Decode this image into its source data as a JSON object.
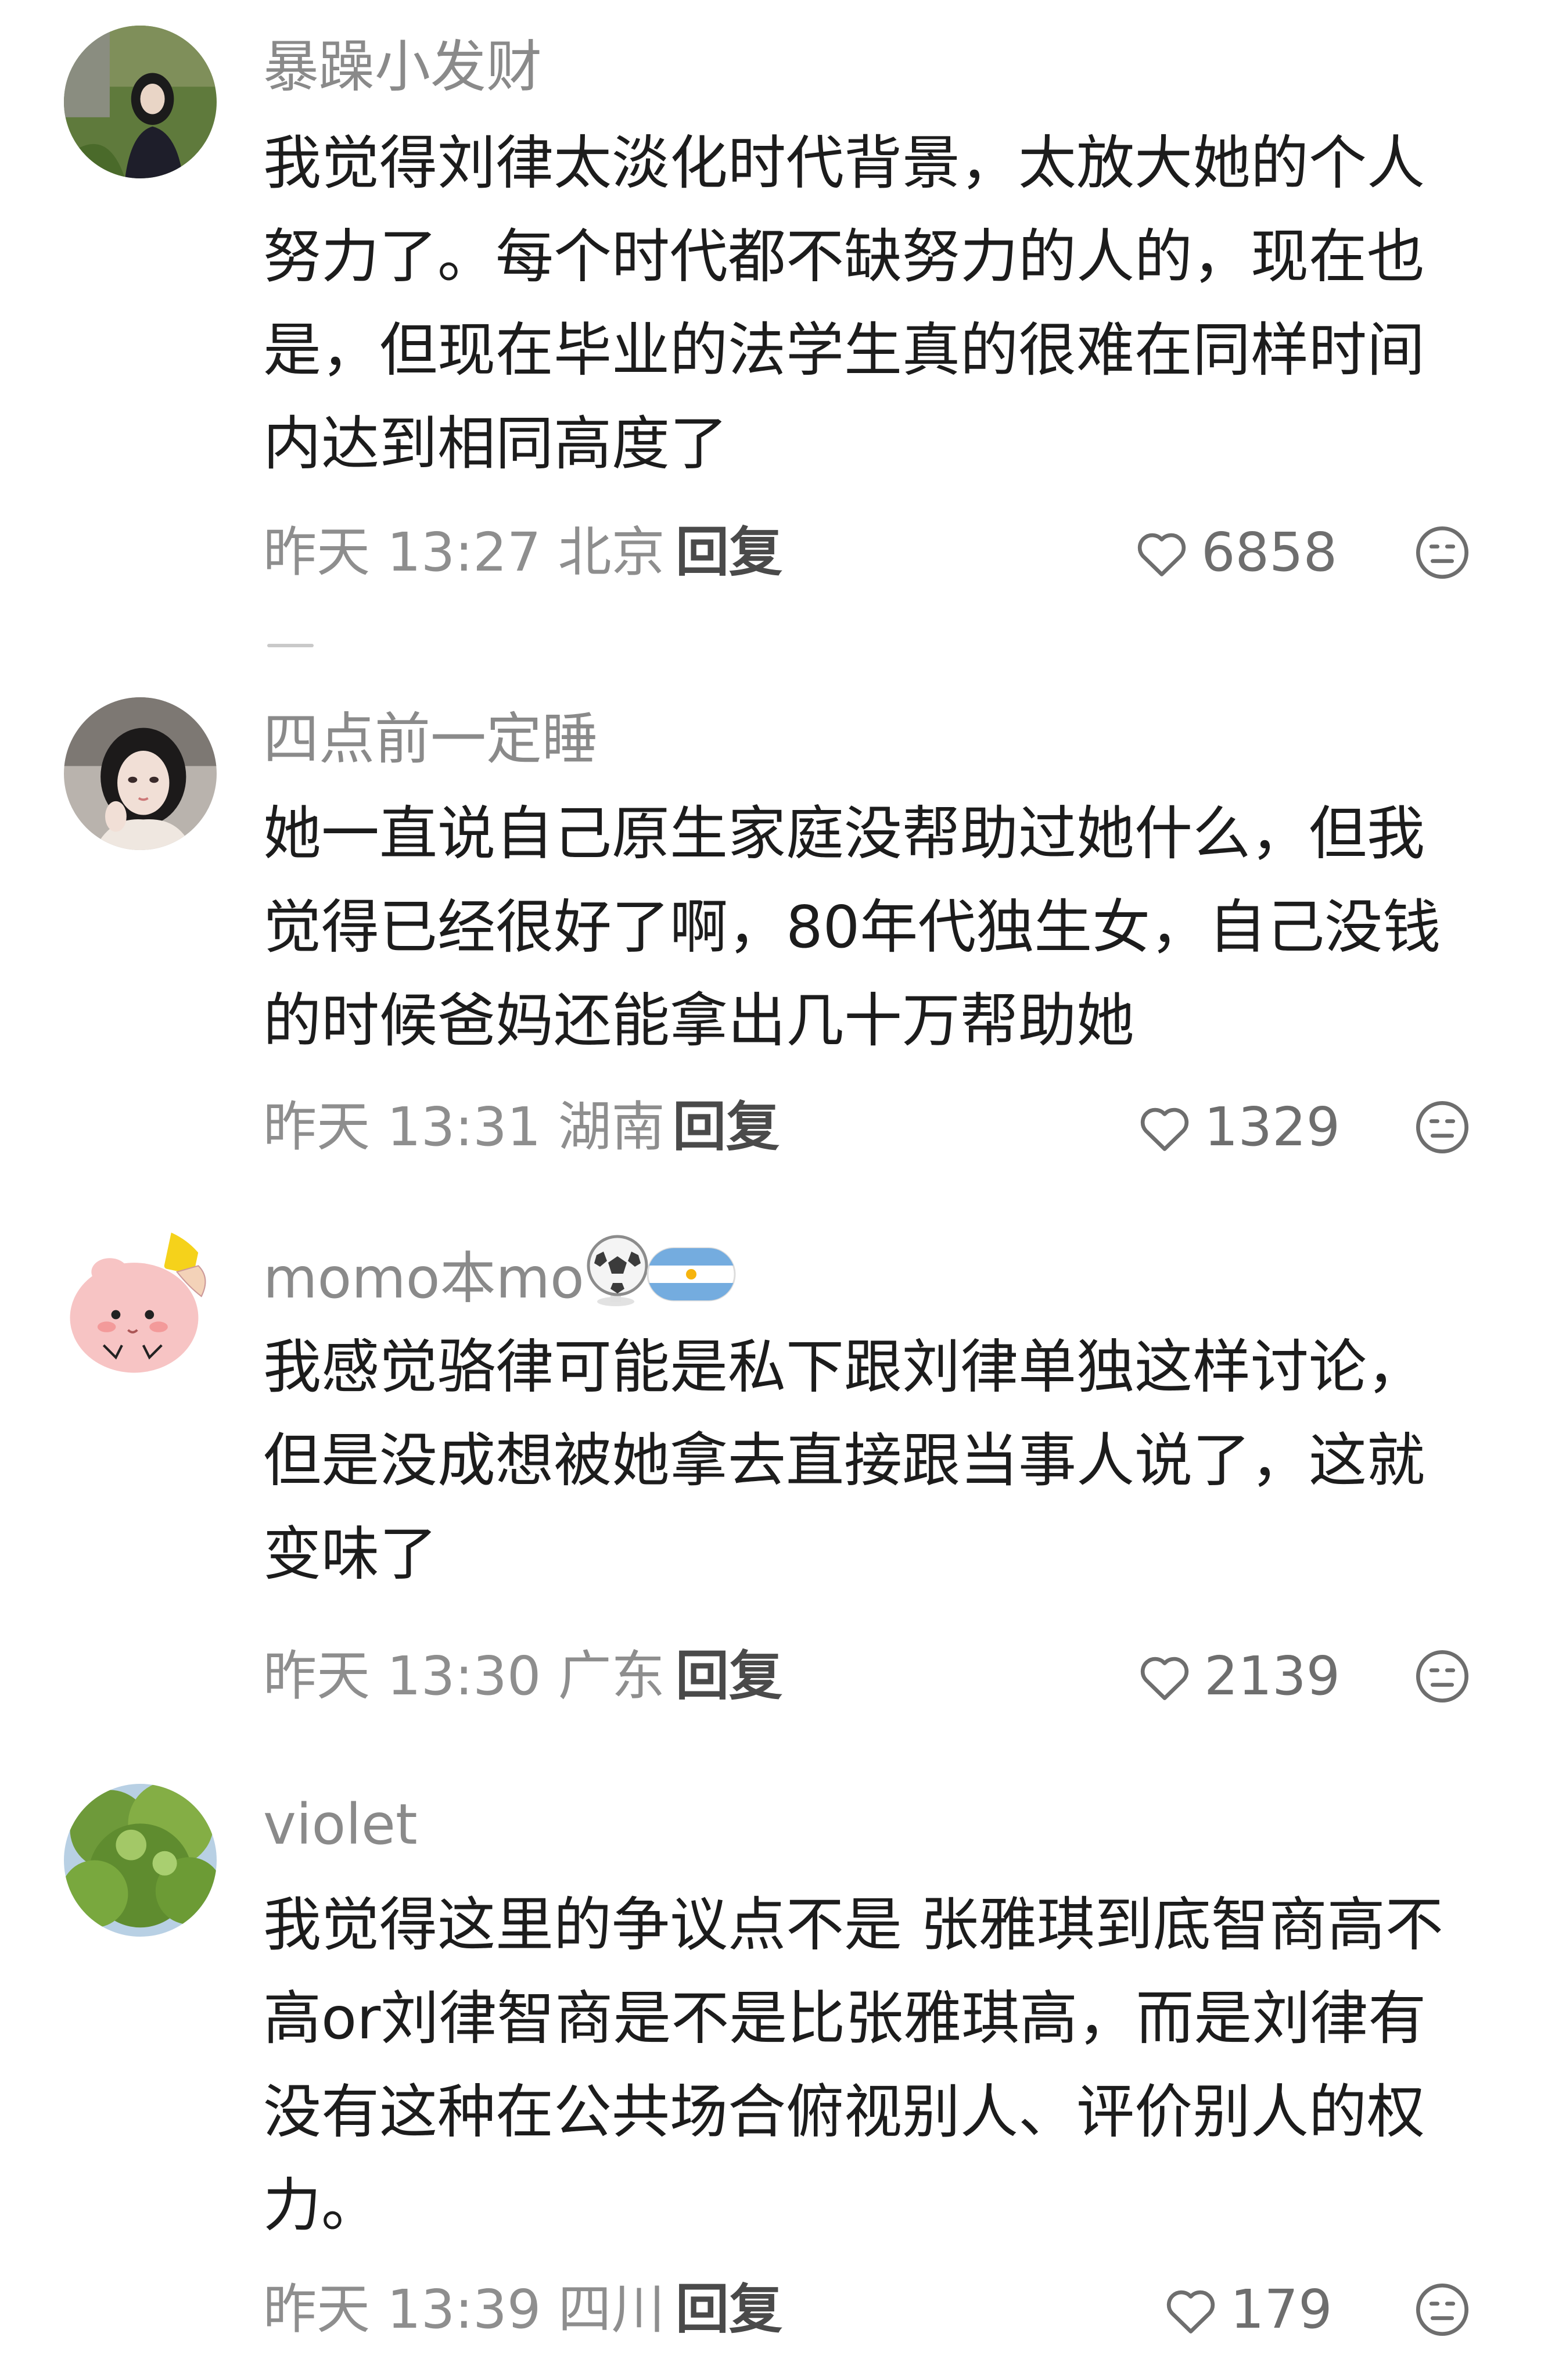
{
  "comments": [
    {
      "username": "暴躁小发财",
      "text": "我觉得刘律太淡化时代背景，太放大她的个人努力了。每个时代都不缺努力的人的，现在也是，但现在毕业的法学生真的很难在同样时间内达到相同高度了",
      "time_location": "昨天 13:27 北京",
      "reply_label": "回复",
      "likes": "6858"
    },
    {
      "username": "四点前一定睡",
      "text": "她一直说自己原生家庭没帮助过她什么，但我觉得已经很好了啊，80年代独生女，自己没钱的时候爸妈还能拿出几十万帮助她",
      "time_location": "昨天 13:31 湖南",
      "reply_label": "回复",
      "likes": "1329"
    },
    {
      "username": "momo本mo",
      "text": "我感觉骆律可能是私下跟刘律单独这样讨论，但是没成想被她拿去直接跟当事人说了，这就变味了",
      "time_location": "昨天 13:30 广东",
      "reply_label": "回复",
      "likes": "2139",
      "badges": [
        "soccer-ball-icon",
        "argentina-flag-icon"
      ]
    },
    {
      "username": "violet",
      "text": "我觉得这里的争议点不是 张雅琪到底智商高不高or刘律智商是不是比张雅琪高，而是刘律有没有这种在公共场合俯视别人、评价别人的权力。",
      "time_location": "昨天 13:39 四川",
      "reply_label": "回复",
      "likes": "179"
    }
  ],
  "icons": {
    "like": "heart-outline-icon",
    "dislike": "neutral-face-icon"
  },
  "colors": {
    "username": "#8a8a8a",
    "body_text": "#1c1c1c",
    "meta": "#8e8e8e",
    "reply": "#4a4a4a"
  }
}
